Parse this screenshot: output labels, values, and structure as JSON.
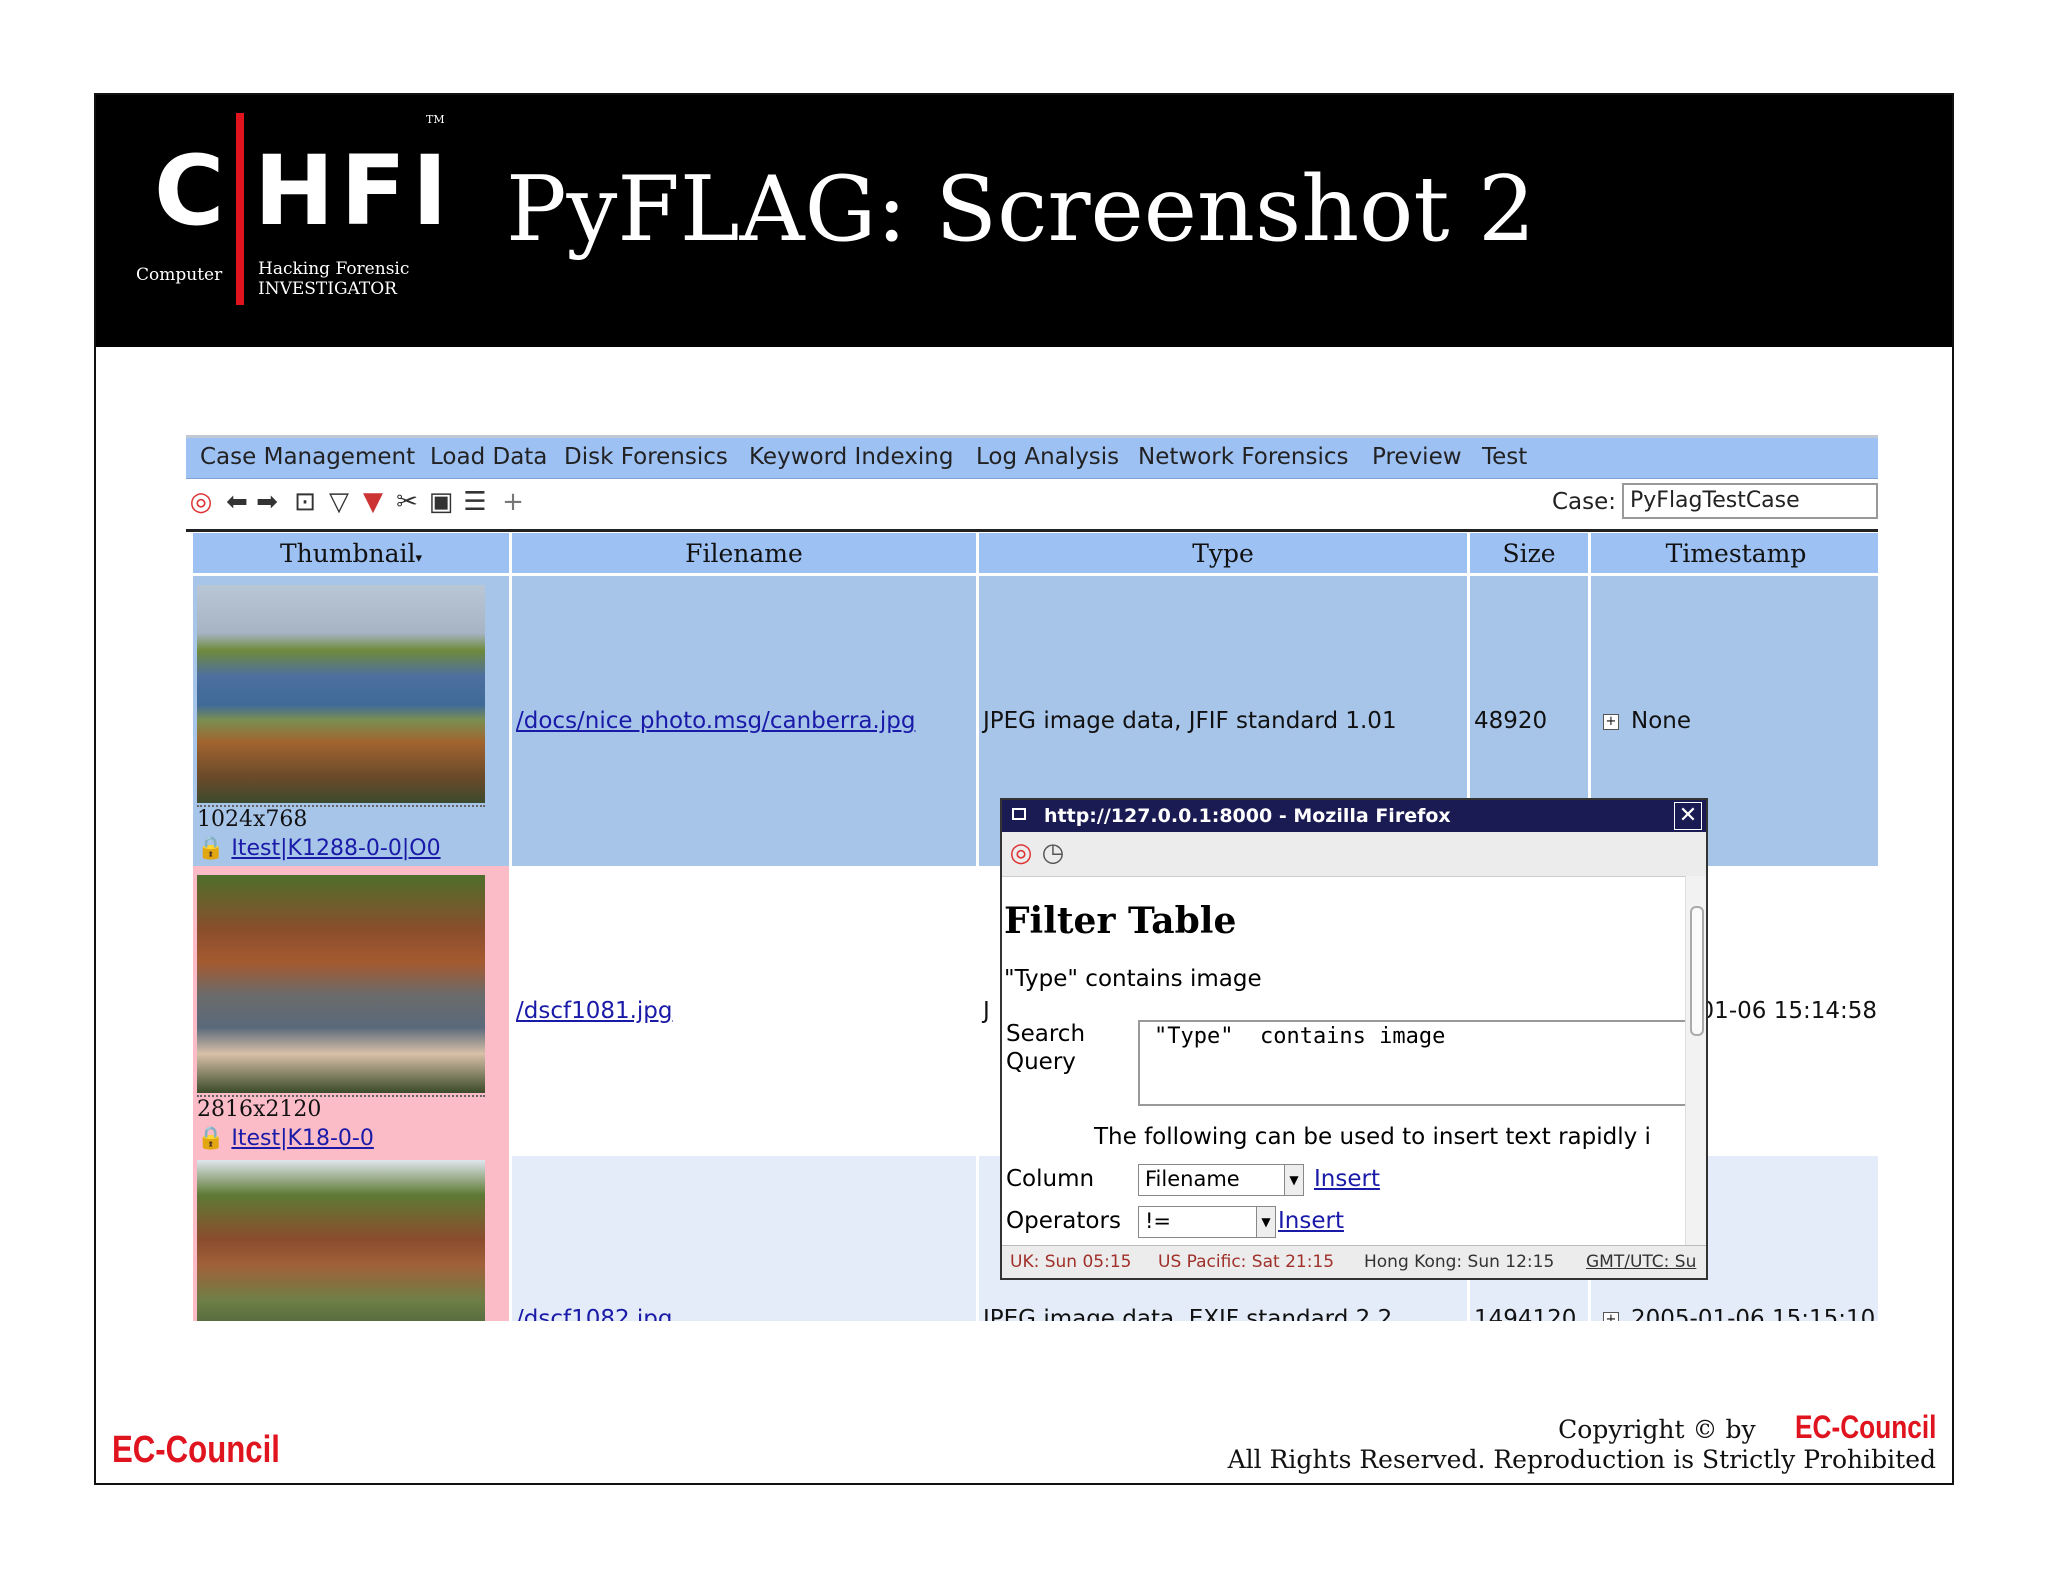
{
  "slide": {
    "title": "PyFLAG: Screenshot 2",
    "logo": {
      "c": "C",
      "hfi": "HFI",
      "tm": "TM",
      "computer": "Computer",
      "hacking_forensic": "Hacking Forensic",
      "investigator": "INVESTIGATOR"
    },
    "footer_brand": "EC-Council",
    "copyright_prefix": "Copyright © by",
    "copyright_brand": "EC-Council",
    "rights": "All Rights Reserved. Reproduction is Strictly Prohibited"
  },
  "app": {
    "menu": [
      "Case Management",
      "Load Data",
      "Disk Forensics",
      "Keyword Indexing",
      "Log Analysis",
      "Network Forensics",
      "Preview",
      "Test"
    ],
    "toolbar_icons": [
      "help-icon",
      "back-icon",
      "forward-icon",
      "goto-icon",
      "filter-icon",
      "remove-filter-icon",
      "tools-icon",
      "save-icon",
      "columns-icon",
      "add-icon"
    ],
    "case_label": "Case:",
    "case_value": "PyFlagTestCase",
    "columns": [
      "Thumbnail",
      "Filename",
      "Type",
      "Size",
      "Timestamp"
    ],
    "rows": [
      {
        "dims": "1024x768",
        "owner": "Itest|K1288-0-0|O0",
        "filename": "/docs/nice photo.msg/canberra.jpg",
        "type": "JPEG image data, JFIF standard 1.01",
        "size": "48920",
        "timestamp": "None"
      },
      {
        "dims": "2816x2120",
        "owner": "Itest|K18-0-0",
        "filename": "/dscf1081.jpg",
        "type": "J",
        "size": "",
        "timestamp": "01-06 15:14:58"
      },
      {
        "dims": "",
        "owner": "",
        "filename": "/dscf1082.jpg",
        "type": "JPEG image data, EXIF standard 2.2",
        "size": "1494120",
        "timestamp": "2005-01-06 15:15:10"
      }
    ]
  },
  "popup": {
    "window_title": "http://127.0.0.1:8000 - Mozilla Firefox",
    "heading": "Filter Table",
    "description": "\"Type\" contains image",
    "search_label_1": "Search",
    "search_label_2": "Query",
    "query_value": "\"Type\"  contains image",
    "hint": "The following can be used to insert text rapidly i",
    "column_label": "Column",
    "column_value": "Filename",
    "operators_label": "Operators",
    "operators_value": "!=",
    "insert_label": "Insert",
    "status": [
      "UK: Sun 05:15",
      "US Pacific: Sat 21:15",
      "Hong Kong: Sun 12:15",
      "GMT/UTC: Su"
    ]
  }
}
